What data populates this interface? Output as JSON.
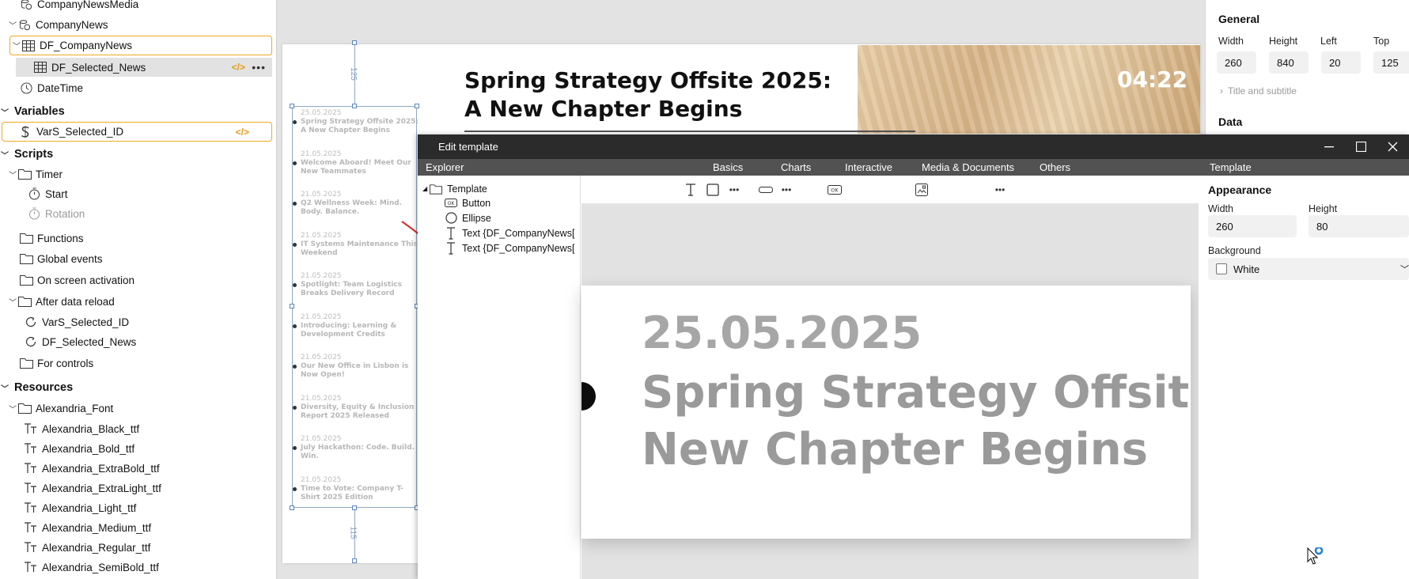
{
  "tree": {
    "items": [
      {
        "label": "CompanyNewsMedia",
        "icon": "database-icon"
      },
      {
        "label": "CompanyNews",
        "icon": "database-icon"
      },
      {
        "label": "DF_CompanyNews",
        "icon": "table-icon"
      },
      {
        "label": "DF_Selected_News",
        "icon": "table-icon"
      },
      {
        "label": "DateTime",
        "icon": "clock-icon"
      }
    ],
    "variables_header": "Variables",
    "variable": "VarS_Selected_ID",
    "scripts_header": "Scripts",
    "scripts": [
      {
        "label": "Timer",
        "icon": "folder-icon"
      },
      {
        "label": "Start",
        "icon": "timer-icon"
      },
      {
        "label": "Rotation",
        "icon": "timer-icon"
      },
      {
        "label": "Functions",
        "icon": "folder-icon"
      },
      {
        "label": "Global events",
        "icon": "folder-icon"
      },
      {
        "label": "On screen activation",
        "icon": "folder-icon"
      },
      {
        "label": "After data reload",
        "icon": "folder-icon"
      },
      {
        "label": "VarS_Selected_ID",
        "icon": "refresh-icon"
      },
      {
        "label": "DF_Selected_News",
        "icon": "refresh-icon"
      },
      {
        "label": "For controls",
        "icon": "folder-icon"
      }
    ],
    "resources_header": "Resources",
    "font_folder": "Alexandria_Font",
    "fonts": [
      "Alexandria_Black_ttf",
      "Alexandria_Bold_ttf",
      "Alexandria_ExtraBold_ttf",
      "Alexandria_ExtraLight_ttf",
      "Alexandria_Light_ttf",
      "Alexandria_Medium_ttf",
      "Alexandria_Regular_ttf",
      "Alexandria_SemiBold_ttf"
    ]
  },
  "canvas": {
    "headline": "Spring Strategy Offsite 2025: A New Chapter Begins",
    "clock": "04:22",
    "dim_top": "125",
    "dim_bottom": "115",
    "news": [
      {
        "date": "25.05.2025",
        "title": "Spring Strategy Offsite 2025: A New Chapter Begins"
      },
      {
        "date": "21.05.2025",
        "title": "Welcome Aboard! Meet Our New Teammates"
      },
      {
        "date": "21.05.2025",
        "title": "Q2 Wellness Week: Mind. Body. Balance."
      },
      {
        "date": "21.05.2025",
        "title": "IT Systems Maintenance This Weekend"
      },
      {
        "date": "21.05.2025",
        "title": "Spotlight: Team Logistics Breaks Delivery Record"
      },
      {
        "date": "21.05.2025",
        "title": "Introducing: Learning & Development Credits"
      },
      {
        "date": "21.05.2025",
        "title": "Our New Office in Lisbon is Now Open!"
      },
      {
        "date": "21.05.2025",
        "title": "Diversity, Equity & Inclusion Report 2025 Released"
      },
      {
        "date": "21.05.2025",
        "title": "July Hackathon: Code. Build. Win."
      },
      {
        "date": "21.05.2025",
        "title": "Time to Vote: Company T-Shirt 2025 Edition"
      }
    ]
  },
  "props": {
    "general_title": "General",
    "width_label": "Width",
    "width": "260",
    "height_label": "Height",
    "height": "840",
    "left_label": "Left",
    "left": "20",
    "top_label": "Top",
    "top": "125",
    "title_subtitle": "Title and subtitle",
    "data_title": "Data"
  },
  "modal": {
    "title": "Edit template",
    "tabs": {
      "explorer": "Explorer",
      "basics": "Basics",
      "charts": "Charts",
      "interactive": "Interactive",
      "media": "Media & Documents",
      "others": "Others",
      "template": "Template"
    },
    "explorer_root": "Template",
    "explorer_items": [
      {
        "label": "Button",
        "icon": "button-icon"
      },
      {
        "label": "Ellipse",
        "icon": "ellipse-icon"
      },
      {
        "label": "Text {DF_CompanyNews[",
        "icon": "text-icon"
      },
      {
        "label": "Text {DF_CompanyNews[",
        "icon": "text-icon"
      }
    ],
    "preview_date": "25.05.2025",
    "preview_title_1": "Spring Strategy Offsite",
    "preview_title_2": "New Chapter Begins",
    "appearance_title": "Appearance",
    "width_label": "Width",
    "width": "260",
    "height_label": "Height",
    "height": "80",
    "background_label": "Background",
    "background_value": "White"
  },
  "colors": {
    "accent": "#f0a825",
    "annotation": "#e0262b",
    "titlebar": "#2b2b2b"
  }
}
